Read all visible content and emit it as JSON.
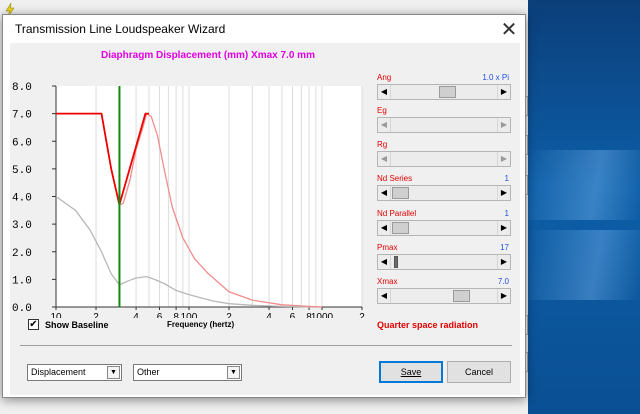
{
  "window": {
    "title": "Transmission Line Loudspeaker Wizard",
    "close_glyph": "✕"
  },
  "chart": {
    "title": "Diaphragm Displacement (mm)   Xmax 7.0 mm",
    "xlabel": "Frequency (hertz)",
    "y_ticks": [
      "8.0",
      "7.0",
      "6.0",
      "5.0",
      "4.0",
      "3.0",
      "2.0",
      "1.0",
      "0.0"
    ],
    "x_tick_labels": [
      "10",
      "2",
      "4",
      "6",
      "8",
      "100",
      "2",
      "4",
      "6",
      "8",
      "1000",
      "2"
    ]
  },
  "chart_data": {
    "type": "line",
    "title": "Diaphragm Displacement (mm)   Xmax 7.0 mm",
    "xlabel": "Frequency (hertz)",
    "ylabel": "",
    "x_scale": "log",
    "xlim": [
      10,
      2000
    ],
    "ylim": [
      0,
      8
    ],
    "grid": true,
    "vertical_marker": {
      "x": 30,
      "color": "#118811"
    },
    "series": [
      {
        "color": "#f28c8c",
        "x": [
          10,
          22,
          26,
          30,
          32,
          36,
          40,
          45,
          48,
          52,
          58,
          65,
          75,
          90,
          110,
          140,
          200,
          300,
          500,
          800,
          1000
        ],
        "y": [
          7.0,
          7.0,
          5.0,
          3.7,
          3.75,
          4.6,
          5.7,
          6.5,
          7.0,
          6.9,
          6.2,
          5.0,
          3.6,
          2.5,
          1.75,
          1.2,
          0.55,
          0.25,
          0.08,
          0.02,
          0.0
        ]
      },
      {
        "color": "#ee0000",
        "x": [
          10,
          22,
          26,
          30,
          47,
          48,
          50
        ],
        "y": [
          7.0,
          7.0,
          5.0,
          3.7,
          7.0,
          7.0,
          7.0
        ]
      },
      {
        "color": "#b8b8b8",
        "x": [
          10,
          14,
          18,
          22,
          26,
          30,
          35,
          40,
          48,
          55,
          65,
          80,
          100,
          150,
          200,
          300,
          500,
          800,
          1000
        ],
        "y": [
          4.0,
          3.5,
          2.8,
          2.0,
          1.2,
          0.8,
          0.95,
          1.05,
          1.1,
          1.0,
          0.85,
          0.6,
          0.45,
          0.22,
          0.12,
          0.06,
          0.02,
          0.0,
          0.0
        ]
      }
    ]
  },
  "sliders": [
    {
      "name": "Ang",
      "value": "1.0 x Pi",
      "thumb": "normal",
      "thumb_frac": 0.55,
      "left_arrow_disabled": false,
      "right_arrow_disabled": false
    },
    {
      "name": "Eg",
      "value": "",
      "thumb": "none",
      "thumb_frac": 0,
      "left_arrow_disabled": true,
      "right_arrow_disabled": true
    },
    {
      "name": "Rg",
      "value": "",
      "thumb": "none",
      "thumb_frac": 0,
      "left_arrow_disabled": true,
      "right_arrow_disabled": true
    },
    {
      "name": "Nd  Series",
      "value": "1",
      "thumb": "normal",
      "thumb_frac": 0.0,
      "left_arrow_disabled": false,
      "right_arrow_disabled": false
    },
    {
      "name": "Nd  Parallel",
      "value": "1",
      "thumb": "normal",
      "thumb_frac": 0.0,
      "left_arrow_disabled": false,
      "right_arrow_disabled": false
    },
    {
      "name": "Pmax",
      "value": "17",
      "thumb": "thin",
      "thumb_frac": 0.02,
      "left_arrow_disabled": false,
      "right_arrow_disabled": false
    },
    {
      "name": "Xmax",
      "value": "7.0",
      "thumb": "normal",
      "thumb_frac": 0.72,
      "left_arrow_disabled": false,
      "right_arrow_disabled": false
    }
  ],
  "controls": {
    "show_baseline_label": "Show Baseline",
    "show_baseline_checked": true,
    "check_glyph": "✔",
    "radiation_label": "Quarter space radiation",
    "plot_select": "Displacement",
    "other_select": "Other",
    "save_label": "Save",
    "cancel_label": "Cancel",
    "arrow_left": "◀",
    "arrow_right": "▶",
    "combo_arrow": "▼"
  },
  "background": {
    "numbers": [
      "8.",
      "7.",
      "6.",
      "5.",
      "4.",
      "3.",
      "2.",
      "1.",
      "0."
    ]
  },
  "colors": {
    "accent": "#0078d7",
    "chart_title": "#e000e0",
    "label_red": "#e00000",
    "value_blue": "#2050e0"
  }
}
